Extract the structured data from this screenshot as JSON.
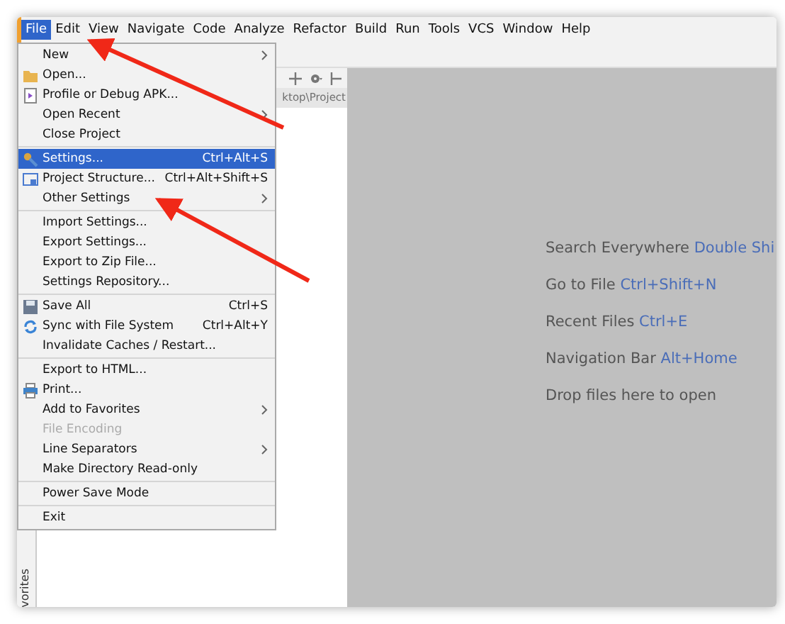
{
  "menu_bar": [
    {
      "label": "File",
      "selected": true
    },
    {
      "label": "Edit",
      "selected": false
    },
    {
      "label": "View",
      "selected": false
    },
    {
      "label": "Navigate",
      "selected": false
    },
    {
      "label": "Code",
      "selected": false
    },
    {
      "label": "Analyze",
      "selected": false
    },
    {
      "label": "Refactor",
      "selected": false
    },
    {
      "label": "Build",
      "selected": false
    },
    {
      "label": "Run",
      "selected": false
    },
    {
      "label": "Tools",
      "selected": false
    },
    {
      "label": "VCS",
      "selected": false
    },
    {
      "label": "Window",
      "selected": false
    },
    {
      "label": "Help",
      "selected": false
    }
  ],
  "file_menu": [
    {
      "kind": "item",
      "label": "New",
      "submenu": true,
      "selected": false,
      "disabled": false
    },
    {
      "kind": "item",
      "label": "Open...",
      "selected": false,
      "disabled": false
    },
    {
      "kind": "item",
      "label": "Profile or Debug APK...",
      "selected": false,
      "disabled": false
    },
    {
      "kind": "item",
      "label": "Open Recent",
      "submenu": true,
      "selected": false,
      "disabled": false
    },
    {
      "kind": "item",
      "label": "Close Project",
      "selected": false,
      "disabled": false
    },
    {
      "kind": "separator"
    },
    {
      "kind": "item",
      "label": "Settings...",
      "shortcut": "Ctrl+Alt+S",
      "selected": true,
      "disabled": false
    },
    {
      "kind": "item",
      "label": "Project Structure...",
      "shortcut": "Ctrl+Alt+Shift+S",
      "selected": false,
      "disabled": false
    },
    {
      "kind": "item",
      "label": "Other Settings",
      "submenu": true,
      "selected": false,
      "disabled": false
    },
    {
      "kind": "separator"
    },
    {
      "kind": "item",
      "label": "Import Settings...",
      "selected": false,
      "disabled": false
    },
    {
      "kind": "item",
      "label": "Export Settings...",
      "selected": false,
      "disabled": false
    },
    {
      "kind": "item",
      "label": "Export to Zip File...",
      "selected": false,
      "disabled": false
    },
    {
      "kind": "item",
      "label": "Settings Repository...",
      "selected": false,
      "disabled": false
    },
    {
      "kind": "separator"
    },
    {
      "kind": "item",
      "label": "Save All",
      "shortcut": "Ctrl+S",
      "selected": false,
      "disabled": false
    },
    {
      "kind": "item",
      "label": "Sync with File System",
      "shortcut": "Ctrl+Alt+Y",
      "selected": false,
      "disabled": false
    },
    {
      "kind": "item",
      "label": "Invalidate Caches / Restart...",
      "selected": false,
      "disabled": false
    },
    {
      "kind": "separator"
    },
    {
      "kind": "item",
      "label": "Export to HTML...",
      "selected": false,
      "disabled": false
    },
    {
      "kind": "item",
      "label": "Print...",
      "selected": false,
      "disabled": false
    },
    {
      "kind": "item",
      "label": "Add to Favorites",
      "submenu": true,
      "selected": false,
      "disabled": false
    },
    {
      "kind": "item",
      "label": "File Encoding",
      "selected": false,
      "disabled": true
    },
    {
      "kind": "item",
      "label": "Line Separators",
      "submenu": true,
      "selected": false,
      "disabled": false
    },
    {
      "kind": "item",
      "label": "Make Directory Read-only",
      "selected": false,
      "disabled": false
    },
    {
      "kind": "separator"
    },
    {
      "kind": "item",
      "label": "Power Save Mode",
      "selected": false,
      "disabled": false
    },
    {
      "kind": "separator"
    },
    {
      "kind": "item",
      "label": "Exit",
      "selected": false,
      "disabled": false
    }
  ],
  "project_panel": {
    "path": "ktop\\Project",
    "side_tab": "vorites"
  },
  "editor_hints": [
    {
      "text": "Search Everywhere",
      "shortcut": "Double Shi"
    },
    {
      "text": "Go to File",
      "shortcut": "Ctrl+Shift+N"
    },
    {
      "text": "Recent Files",
      "shortcut": "Ctrl+E"
    },
    {
      "text": "Navigation Bar",
      "shortcut": "Alt+Home"
    },
    {
      "text": "Drop files here to open"
    }
  ]
}
